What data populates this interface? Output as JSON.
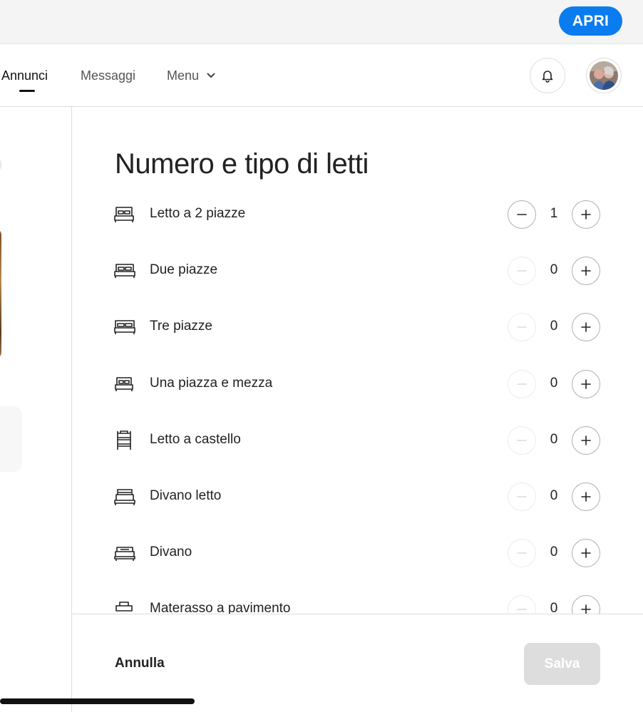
{
  "banner": {
    "open_label": "APRI"
  },
  "nav": {
    "tabs": [
      {
        "label": "Annunci",
        "active": true
      },
      {
        "label": "Messaggi",
        "active": false
      },
      {
        "label": "Menu",
        "active": false
      }
    ]
  },
  "main": {
    "title": "Numero e tipo di letti",
    "beds": [
      {
        "label": "Letto a 2 piazze",
        "count": "1",
        "icon": "double-bed-icon",
        "minus_enabled": true
      },
      {
        "label": "Due piazze",
        "count": "0",
        "icon": "queen-bed-icon",
        "minus_enabled": false
      },
      {
        "label": "Tre piazze",
        "count": "0",
        "icon": "king-bed-icon",
        "minus_enabled": false
      },
      {
        "label": "Una piazza e mezza",
        "count": "0",
        "icon": "small-double-bed-icon",
        "minus_enabled": false
      },
      {
        "label": "Letto a castello",
        "count": "0",
        "icon": "bunk-bed-icon",
        "minus_enabled": false
      },
      {
        "label": "Divano letto",
        "count": "0",
        "icon": "sofa-bed-icon",
        "minus_enabled": false
      },
      {
        "label": "Divano",
        "count": "0",
        "icon": "couch-icon",
        "minus_enabled": false
      },
      {
        "label": "Materasso a pavimento",
        "count": "0",
        "icon": "floor-mattress-icon",
        "minus_enabled": false
      }
    ]
  },
  "footer": {
    "cancel_label": "Annulla",
    "save_label": "Salva"
  },
  "colors": {
    "accent": "#0a7cf0",
    "text": "#222222",
    "disabled": "#dddddd"
  }
}
